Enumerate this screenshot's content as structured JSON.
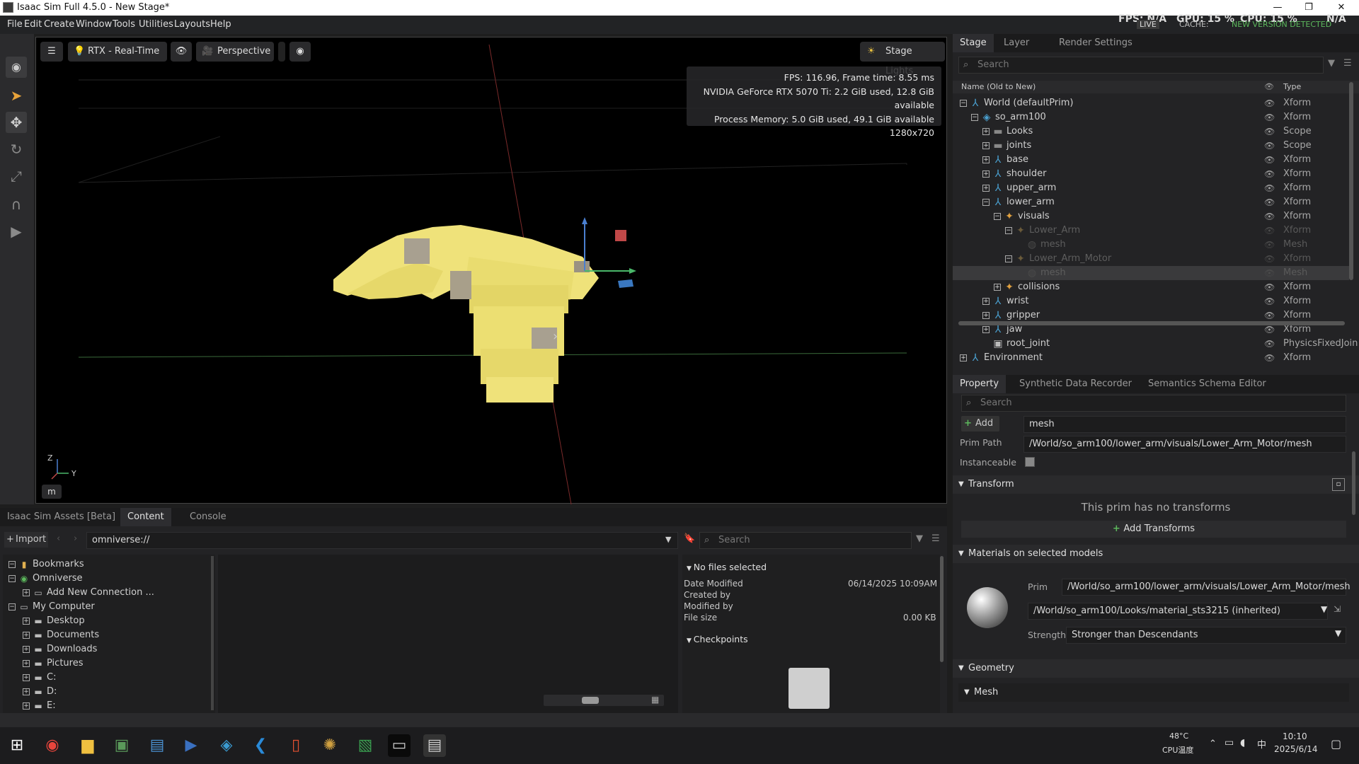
{
  "titlebar": {
    "title": "Isaac Sim Full 4.5.0 - New Stage*",
    "minimize": "—",
    "maximize": "❐",
    "close": "✕"
  },
  "menubar": {
    "items": [
      "File",
      "Edit",
      "Create",
      "Window",
      "Tools",
      "Utilities",
      "Layouts",
      "Help"
    ],
    "fps": "FPS: N/A",
    "gpu": "GPU: 15 %",
    "cpu": "CPU: 15 %",
    "mem": "N/A",
    "live": "LIVE",
    "cache": "CACHE:",
    "new_version": "NEW VERSION DETECTED"
  },
  "viewport": {
    "render_mode": "RTX - Real-Time",
    "camera": "Perspective",
    "stage_lights": "Stage Lights",
    "info_lines": [
      "FPS: 116.96, Frame time: 8.55 ms",
      "NVIDIA GeForce RTX 5070 Ti: 2.2 GiB used, 12.8 GiB available",
      "Process Memory: 5.0 GiB used, 49.1 GiB available",
      "1280x720"
    ],
    "axis_z": "Z",
    "axis_y": "Y",
    "unit": "m"
  },
  "stage": {
    "tabs": [
      "Stage",
      "Layer",
      "Render Settings"
    ],
    "search_placeholder": "Search",
    "col_name": "Name (Old to New)",
    "col_type": "Type",
    "rows": [
      {
        "label": "World (defaultPrim)",
        "type": "Xform",
        "exp": "−"
      },
      {
        "label": "so_arm100",
        "type": "Xform",
        "exp": "−"
      },
      {
        "label": "Looks",
        "type": "Scope",
        "exp": "+"
      },
      {
        "label": "joints",
        "type": "Scope",
        "exp": "+"
      },
      {
        "label": "base",
        "type": "Xform",
        "exp": "+"
      },
      {
        "label": "shoulder",
        "type": "Xform",
        "exp": "+"
      },
      {
        "label": "upper_arm",
        "type": "Xform",
        "exp": "+"
      },
      {
        "label": "lower_arm",
        "type": "Xform",
        "exp": "−"
      },
      {
        "label": "visuals",
        "type": "Xform",
        "exp": "−"
      },
      {
        "label": "Lower_Arm",
        "type": "Xform",
        "exp": "−"
      },
      {
        "label": "mesh",
        "type": "Mesh",
        "exp": ""
      },
      {
        "label": "Lower_Arm_Motor",
        "type": "Xform",
        "exp": "−"
      },
      {
        "label": "mesh",
        "type": "Mesh",
        "exp": ""
      },
      {
        "label": "collisions",
        "type": "Xform",
        "exp": "+"
      },
      {
        "label": "wrist",
        "type": "Xform",
        "exp": "+"
      },
      {
        "label": "gripper",
        "type": "Xform",
        "exp": "+"
      },
      {
        "label": "jaw",
        "type": "Xform",
        "exp": "+"
      },
      {
        "label": "root_joint",
        "type": "PhysicsFixedJoin",
        "exp": ""
      },
      {
        "label": "Environment",
        "type": "Xform",
        "exp": "+"
      }
    ]
  },
  "property": {
    "tabs": [
      "Property",
      "Synthetic Data Recorder",
      "Semantics Schema Editor"
    ],
    "search_placeholder": "Search",
    "add_label": "Add",
    "name_value": "mesh",
    "prim_path_label": "Prim Path",
    "prim_path_value": "/World/so_arm100/lower_arm/visuals/Lower_Arm_Motor/mesh",
    "instanceable_label": "Instanceable",
    "transform_header": "Transform",
    "no_transforms": "This prim has no transforms",
    "add_transforms": "Add Transforms",
    "materials_header": "Materials on selected models",
    "prim_label": "Prim",
    "prim_value": "/World/so_arm100/lower_arm/visuals/Lower_Arm_Motor/mesh",
    "material_value": "/World/so_arm100/Looks/material_sts3215 (inherited)",
    "strength_label": "Strength",
    "strength_value": "Stronger than Descendants",
    "geometry_header": "Geometry",
    "mesh_header": "Mesh"
  },
  "content": {
    "tabs": [
      "Isaac Sim Assets [Beta]",
      "Content",
      "Console"
    ],
    "import_label": "Import",
    "path_value": "omniverse://",
    "search_placeholder": "Search",
    "tree": [
      {
        "label": "Bookmarks",
        "exp": "−",
        "indent": 0
      },
      {
        "label": "Omniverse",
        "exp": "−",
        "indent": 0
      },
      {
        "label": "Add New Connection ...",
        "exp": "+",
        "indent": 1
      },
      {
        "label": "My Computer",
        "exp": "−",
        "indent": 0
      },
      {
        "label": "Desktop",
        "exp": "+",
        "indent": 1
      },
      {
        "label": "Documents",
        "exp": "+",
        "indent": 1
      },
      {
        "label": "Downloads",
        "exp": "+",
        "indent": 1
      },
      {
        "label": "Pictures",
        "exp": "+",
        "indent": 1
      },
      {
        "label": "C:",
        "exp": "+",
        "indent": 1
      },
      {
        "label": "D:",
        "exp": "+",
        "indent": 1
      },
      {
        "label": "E:",
        "exp": "+",
        "indent": 1
      }
    ],
    "details_header": "No files selected",
    "date_modified_label": "Date Modified",
    "date_modified_value": "06/14/2025 10:09AM",
    "created_by_label": "Created by",
    "modified_by_label": "Modified by",
    "file_size_label": "File size",
    "file_size_value": "0.00 KB",
    "checkpoints_header": "Checkpoints"
  },
  "taskbar": {
    "temp": "48°C",
    "temp_label": "CPU温度",
    "ime": "中",
    "time": "10:10",
    "date": "2025/6/14"
  }
}
